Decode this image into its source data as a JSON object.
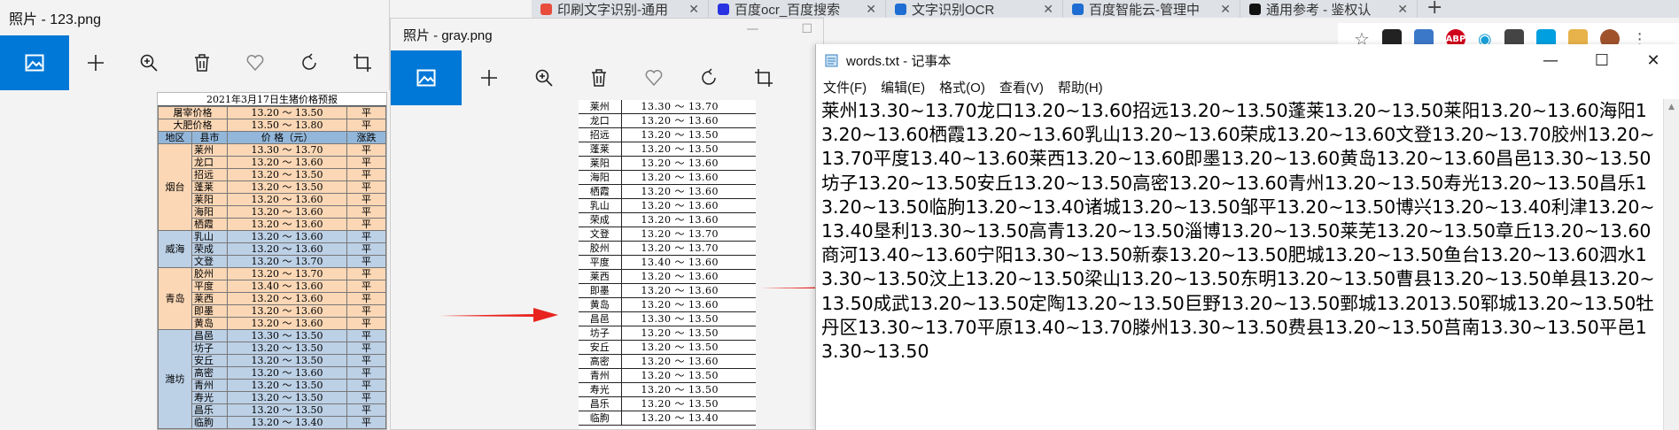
{
  "browser": {
    "tabs": [
      {
        "label": "印刷文字识别-通用",
        "color": "#e74c3c"
      },
      {
        "label": "百度ocr_百度搜索",
        "color": "#2932e1"
      },
      {
        "label": "文字识别OCR",
        "color": "#1d6dd2"
      },
      {
        "label": "百度智能云-管理中",
        "color": "#1d6dd2"
      },
      {
        "label": "通用参考 - 鉴权认",
        "color": "#111111"
      }
    ],
    "new_tab": "+",
    "extensions": [
      "ABP"
    ]
  },
  "photos1": {
    "title": "照片 - 123.png",
    "doc_caption": "2021年3月17日生猪价格预报",
    "summary_rows": [
      {
        "label": "屠宰价格",
        "price": "13.20 ～ 13.50",
        "trend": "平"
      },
      {
        "label": "大肥价格",
        "price": "13.50 ～ 13.80",
        "trend": "平"
      }
    ],
    "header": {
      "region": "地区",
      "county": "县市",
      "price": "价 格（元）",
      "trend": "涨跌"
    },
    "groups": [
      {
        "region": "烟台",
        "rows": [
          [
            "莱州",
            "13.30 ～ 13.70",
            "平"
          ],
          [
            "龙口",
            "13.20 ～ 13.60",
            "平"
          ],
          [
            "招远",
            "13.20 ～ 13.50",
            "平"
          ],
          [
            "蓬莱",
            "13.20 ～ 13.50",
            "平"
          ],
          [
            "莱阳",
            "13.20 ～ 13.60",
            "平"
          ],
          [
            "海阳",
            "13.20 ～ 13.60",
            "平"
          ],
          [
            "栖霞",
            "13.20 ～ 13.60",
            "平"
          ]
        ]
      },
      {
        "region": "威海",
        "rows": [
          [
            "乳山",
            "13.20 ～ 13.60",
            "平"
          ],
          [
            "荣成",
            "13.20 ～ 13.60",
            "平"
          ],
          [
            "文登",
            "13.20 ～ 13.70",
            "平"
          ]
        ]
      },
      {
        "region": "青岛",
        "rows": [
          [
            "胶州",
            "13.20 ～ 13.70",
            "平"
          ],
          [
            "平度",
            "13.40 ～ 13.60",
            "平"
          ],
          [
            "莱西",
            "13.20 ～ 13.60",
            "平"
          ],
          [
            "即墨",
            "13.20 ～ 13.60",
            "平"
          ],
          [
            "黄岛",
            "13.20 ～ 13.60",
            "平"
          ]
        ]
      },
      {
        "region": "潍坊",
        "rows": [
          [
            "昌邑",
            "13.30 ～ 13.50",
            "平"
          ],
          [
            "坊子",
            "13.20 ～ 13.50",
            "平"
          ],
          [
            "安丘",
            "13.20 ～ 13.50",
            "平"
          ],
          [
            "高密",
            "13.20 ～ 13.60",
            "平"
          ],
          [
            "青州",
            "13.20 ～ 13.50",
            "平"
          ],
          [
            "寿光",
            "13.20 ～ 13.50",
            "平"
          ],
          [
            "昌乐",
            "13.20 ～ 13.50",
            "平"
          ],
          [
            "临朐",
            "13.20 ～ 13.40",
            "平"
          ]
        ]
      }
    ]
  },
  "photos2": {
    "title": "照片 - gray.png",
    "rows": [
      [
        "莱州",
        "13.30 ～ 13.70"
      ],
      [
        "龙口",
        "13.20 ～ 13.60"
      ],
      [
        "招远",
        "13.20 ～ 13.50"
      ],
      [
        "蓬莱",
        "13.20 ～ 13.50"
      ],
      [
        "莱阳",
        "13.20 ～ 13.60"
      ],
      [
        "海阳",
        "13.20 ～ 13.60"
      ],
      [
        "栖霞",
        "13.20 ～ 13.60"
      ],
      [
        "乳山",
        "13.20 ～ 13.60"
      ],
      [
        "荣成",
        "13.20 ～ 13.60"
      ],
      [
        "文登",
        "13.20 ～ 13.70"
      ],
      [
        "胶州",
        "13.20 ～ 13.70"
      ],
      [
        "平度",
        "13.40 ～ 13.60"
      ],
      [
        "莱西",
        "13.20 ～ 13.60"
      ],
      [
        "即墨",
        "13.20 ～ 13.60"
      ],
      [
        "黄岛",
        "13.20 ～ 13.60"
      ],
      [
        "昌邑",
        "13.30 ～ 13.50"
      ],
      [
        "坊子",
        "13.20 ～ 13.50"
      ],
      [
        "安丘",
        "13.20 ～ 13.50"
      ],
      [
        "高密",
        "13.20 ～ 13.60"
      ],
      [
        "青州",
        "13.20 ～ 13.50"
      ],
      [
        "寿光",
        "13.20 ～ 13.50"
      ],
      [
        "昌乐",
        "13.20 ～ 13.50"
      ],
      [
        "临朐",
        "13.20 ～ 13.40"
      ]
    ]
  },
  "notepad": {
    "title": "words.txt - 记事本",
    "menu": [
      "文件(F)",
      "编辑(E)",
      "格式(O)",
      "查看(V)",
      "帮助(H)"
    ],
    "content": "莱州13.30~13.70龙口13.20~13.60招远13.20~13.50蓬莱13.20~13.50莱阳13.20~13.60海阳13.20~13.60栖霞13.20~13.60乳山13.20~13.60荣成13.20~13.60文登13.20~13.70胶州13.20~13.70平度13.40~13.60莱西13.20~13.60即墨13.20~13.60黄岛13.20~13.60昌邑13.30~13.50坊子13.20~13.50安丘13.20~13.50高密13.20~13.60青州13.20~13.50寿光13.20~13.50昌乐13.20~13.50临朐13.20~13.40诸城13.20~13.50邹平13.20~13.50博兴13.20~13.40利津13.20~13.40垦利13.30~13.50高青13.20~13.50淄博13.20~13.50莱芜13.20~13.50章丘13.20~13.60商河13.40~13.60宁阳13.30~13.50新泰13.20~13.50肥城13.20~13.50鱼台13.20~13.60泗水13.30~13.50汶上13.20~13.50梁山13.20~13.50东明13.20~13.50曹县13.20~13.50单县13.20~13.50成武13.20~13.50定陶13.20~13.50巨野13.20~13.50鄄城13.2013.50郓城13.20~13.50牡丹区13.30~13.70平原13.40~13.70滕州13.30~13.50费县13.20~13.50莒南13.30~13.50平邑13.30~13.50"
  }
}
